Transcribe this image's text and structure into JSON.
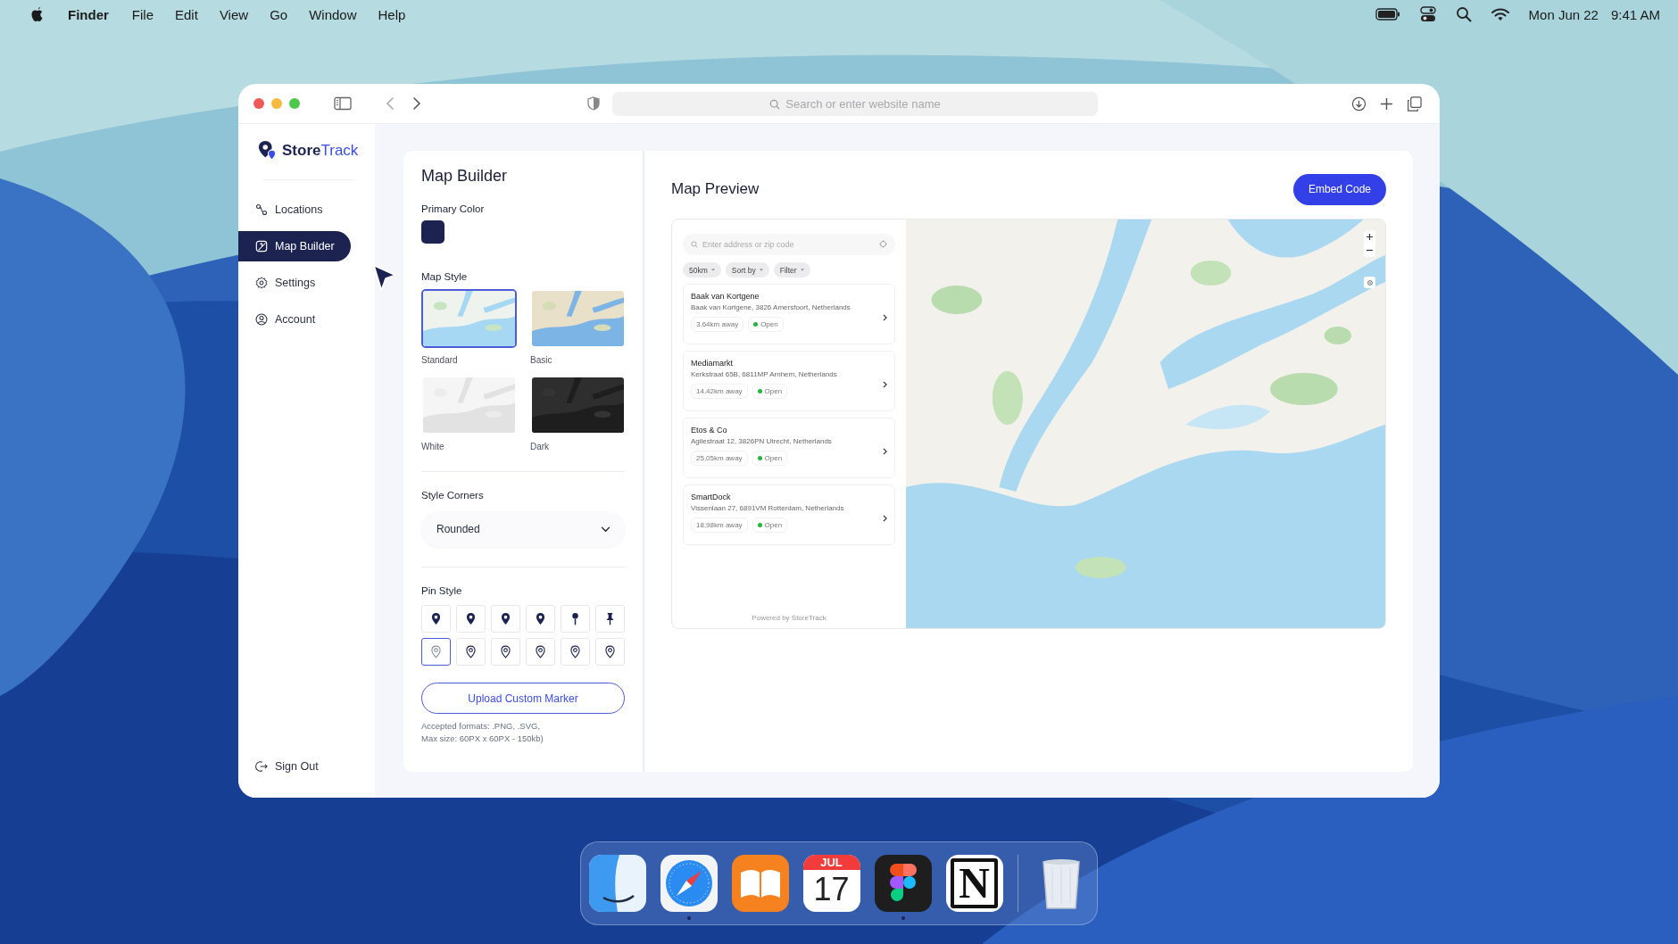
{
  "menu_bar": {
    "app": "Finder",
    "menus": [
      "File",
      "Edit",
      "View",
      "Go",
      "Window",
      "Help"
    ],
    "date": "Mon Jun 22",
    "time": "9:41 AM"
  },
  "browser": {
    "address_placeholder": "Search or enter website name"
  },
  "sidebar": {
    "brand_first": "Store",
    "brand_second": "Track",
    "items": [
      {
        "label": "Locations",
        "kind": "locations",
        "selected": false
      },
      {
        "label": "Map Builder",
        "kind": "map",
        "selected": true
      },
      {
        "label": "Settings",
        "kind": "settings",
        "selected": false
      },
      {
        "label": "Account",
        "kind": "account",
        "selected": false
      }
    ],
    "sign_out": "Sign Out"
  },
  "builder": {
    "title": "Map Builder",
    "primary_color_label": "Primary Color",
    "map_style_label": "Map Style",
    "map_styles": [
      {
        "label": "Standard",
        "kind": "standard",
        "selected": true
      },
      {
        "label": "Basic",
        "kind": "basic",
        "selected": false
      },
      {
        "label": "White",
        "kind": "white",
        "selected": false
      },
      {
        "label": "Dark",
        "kind": "dark",
        "selected": false
      }
    ],
    "corners_label": "Style Corners",
    "corners_value": "Rounded",
    "pin_style_label": "Pin Style",
    "pins": [
      {
        "kind": "solid",
        "selected": false
      },
      {
        "kind": "solid",
        "selected": false
      },
      {
        "kind": "solid",
        "selected": false
      },
      {
        "kind": "solid",
        "selected": false
      },
      {
        "kind": "needle",
        "selected": false
      },
      {
        "kind": "pushpin",
        "selected": false
      },
      {
        "kind": "outline",
        "selected": true
      },
      {
        "kind": "outline",
        "selected": false
      },
      {
        "kind": "outline",
        "selected": false
      },
      {
        "kind": "outline",
        "selected": false
      },
      {
        "kind": "outline",
        "selected": false
      },
      {
        "kind": "outline",
        "selected": false
      }
    ],
    "upload_button": "Upload Custom Marker",
    "formats_note": "Accepted formats: .PNG, .SVG,",
    "size_note": "Max size: 60PX x 60PX - 150kb)"
  },
  "preview": {
    "title": "Map Preview",
    "embed_button": "Embed Code",
    "search_placeholder": "Enter address or zip code",
    "chips": [
      "50km",
      "Sort by",
      "Filter"
    ],
    "stores": [
      {
        "name": "Baak van Kortgene",
        "address": "Baak van Kortgene, 3826 Amersfoort, Netherlands",
        "distance": "3.64km away",
        "status": "Open",
        "open": true
      },
      {
        "name": "Mediamarkt",
        "address": "Kerkstraat 65B, 6811MP Arnhem, Netherlands",
        "distance": "14.42km away",
        "status": "Open",
        "open": true
      },
      {
        "name": "Etos & Co",
        "address": "Agilestraat 12, 3826PN Utrecht, Netherlands",
        "distance": "25,05km away",
        "status": "Open",
        "open": true
      },
      {
        "name": "SmartDock",
        "address": "Vissenlaan 27, 6891VM Rotterdam, Netherlands",
        "distance": "18,98km away",
        "status": "Open",
        "open": true
      }
    ],
    "footer": "Powered by StoreTrack"
  },
  "dock": [
    {
      "kind": "finder",
      "running": false
    },
    {
      "kind": "safari",
      "running": true
    },
    {
      "kind": "books",
      "running": false
    },
    {
      "kind": "calendar",
      "running": false,
      "month": "JUL",
      "day": "17"
    },
    {
      "kind": "figma",
      "running": true
    },
    {
      "kind": "notion",
      "running": false,
      "letter": "N"
    },
    {
      "kind": "trash",
      "running": false
    }
  ]
}
